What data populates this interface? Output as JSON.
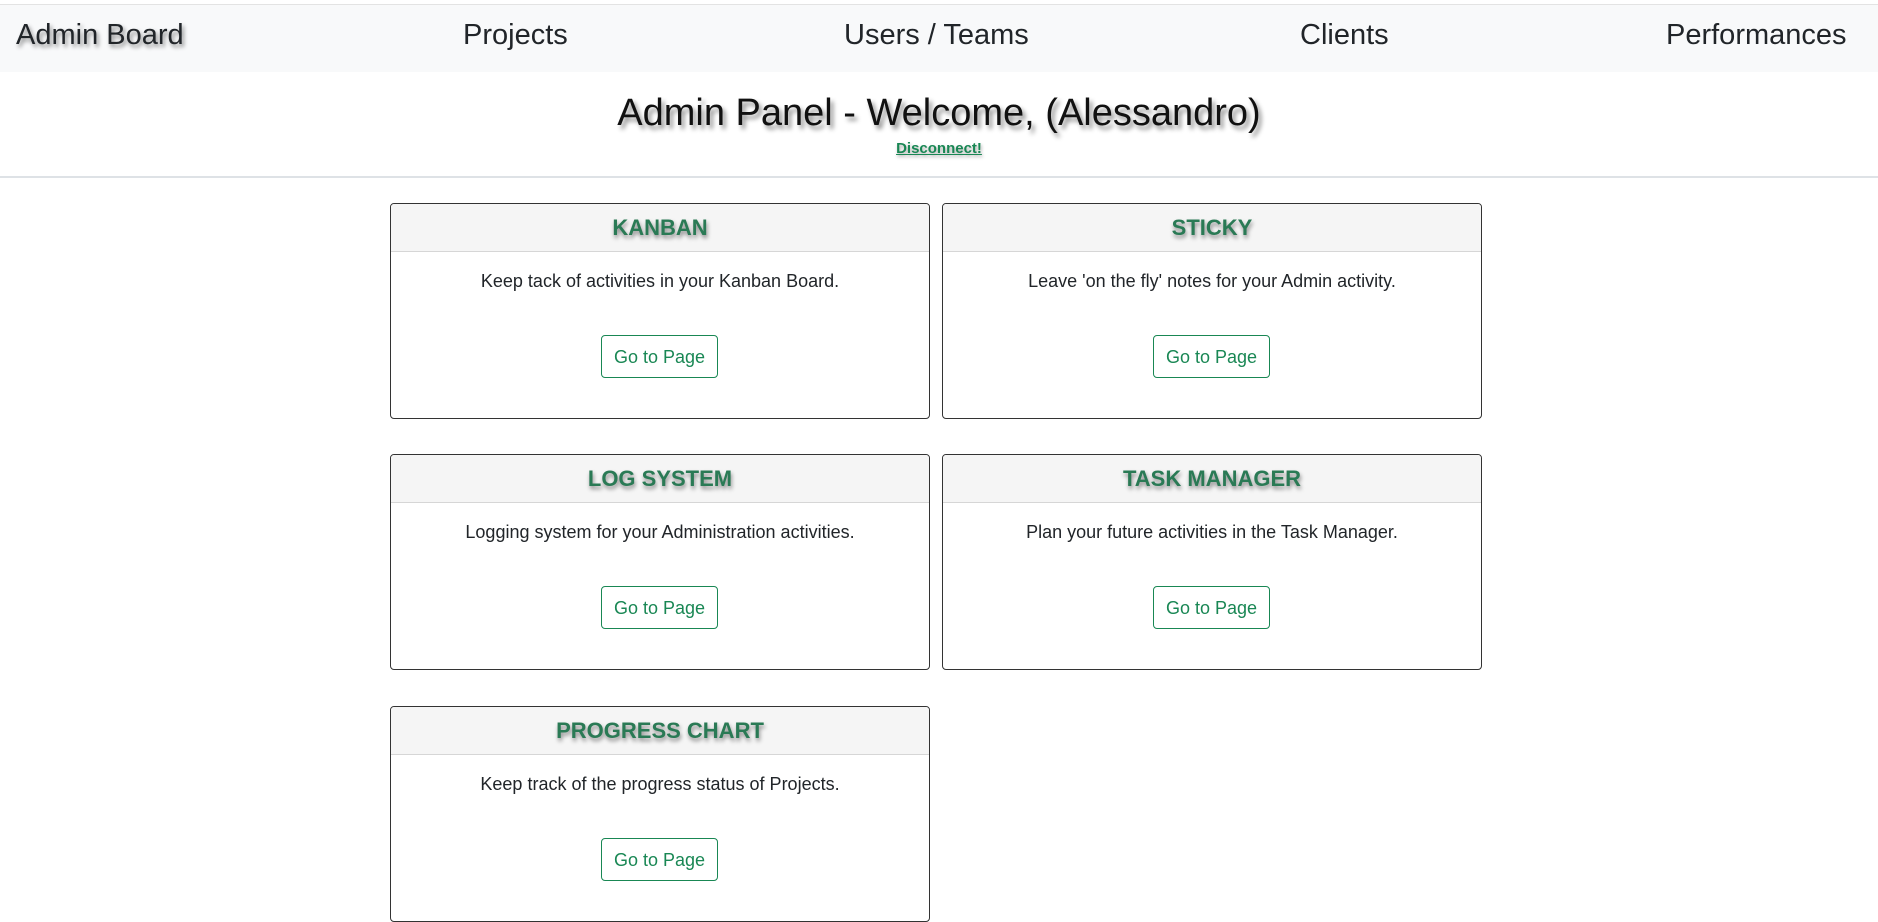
{
  "nav": {
    "brand": "Admin Board",
    "items": [
      {
        "label": "Projects"
      },
      {
        "label": "Users / Teams"
      },
      {
        "label": "Clients"
      },
      {
        "label": "Performances"
      }
    ]
  },
  "header": {
    "title": "Admin Panel - Welcome, (Alessandro)",
    "disconnect": "Disconnect!"
  },
  "cards": [
    {
      "title": "KANBAN",
      "text": "Keep tack of activities in your Kanban Board.",
      "button": "Go to Page"
    },
    {
      "title": "STICKY",
      "text": "Leave 'on the fly' notes for your Admin activity.",
      "button": "Go to Page"
    },
    {
      "title": "LOG SYSTEM",
      "text": "Logging system for your Administration activities.",
      "button": "Go to Page"
    },
    {
      "title": "TASK MANAGER",
      "text": "Plan your future activities in the Task Manager.",
      "button": "Go to Page"
    },
    {
      "title": "PROGRESS CHART",
      "text": "Keep track of the progress status of Projects.",
      "button": "Go to Page"
    }
  ],
  "colors": {
    "accent": "#198754",
    "card_title": "#2a7a55",
    "navbar_bg": "#f8f9fa"
  }
}
